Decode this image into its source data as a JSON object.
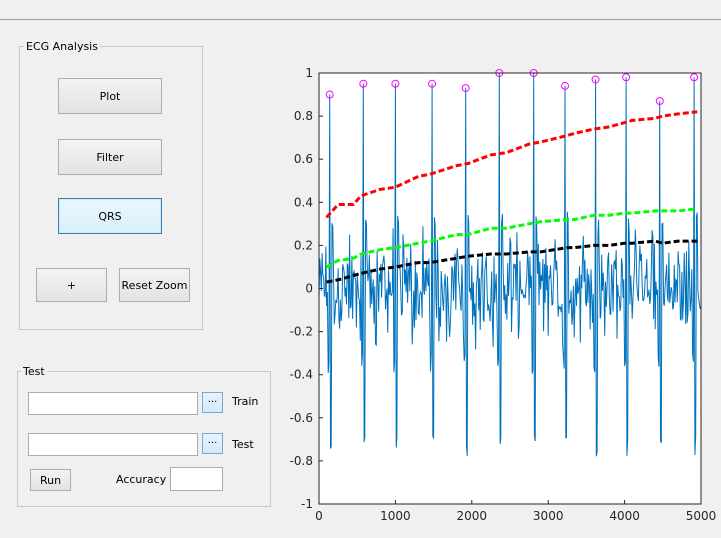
{
  "ecg_panel": {
    "title": "ECG Analysis",
    "plot_label": "Plot",
    "filter_label": "Filter",
    "qrs_label": "QRS",
    "plus_label": "+",
    "reset_zoom_label": "Reset Zoom"
  },
  "test_panel": {
    "title": "Test",
    "train_input_value": "",
    "train_browse_label": "...",
    "train_label": "Train",
    "test_input_value": "",
    "test_browse_label": "...",
    "test_label": "Test",
    "run_label": "Run",
    "accuracy_label": "Accuracy",
    "accuracy_value": ""
  },
  "colors": {
    "signal": "#0072bd",
    "peaks": "#ff00ff",
    "red_line": "#ff0000",
    "green_line": "#00ff00",
    "black_line": "#000000"
  },
  "chart_data": {
    "type": "line",
    "xlim": [
      0,
      5000
    ],
    "ylim": [
      -1,
      1
    ],
    "x_ticks": [
      0,
      1000,
      2000,
      3000,
      4000,
      5000
    ],
    "y_ticks": [
      -1,
      -0.8,
      -0.6,
      -0.4,
      -0.2,
      0,
      0.2,
      0.4,
      0.6,
      0.8,
      1
    ],
    "x_tick_labels": [
      "0",
      "1000",
      "2000",
      "3000",
      "4000",
      "5000"
    ],
    "y_tick_labels": [
      "-1",
      "-0.8",
      "-0.6",
      "-0.4",
      "-0.2",
      "0",
      "0.2",
      "0.4",
      "0.6",
      "0.8",
      "1"
    ],
    "grid": false,
    "peaks": {
      "x": [
        140,
        580,
        1000,
        1480,
        1920,
        2360,
        2810,
        3220,
        3620,
        4020,
        4460,
        4910
      ],
      "y": [
        0.9,
        0.95,
        0.95,
        0.95,
        0.93,
        1.0,
        1.0,
        0.94,
        0.97,
        0.98,
        0.87,
        0.98
      ]
    },
    "red_threshold": {
      "x": [
        100,
        250,
        450,
        550,
        800,
        1000,
        1300,
        1450,
        1800,
        1950,
        2250,
        2450,
        2750,
        2900,
        3250,
        3350,
        3600,
        3800,
        4000,
        4100,
        4400,
        4500,
        4700,
        4950
      ],
      "y": [
        0.33,
        0.39,
        0.39,
        0.43,
        0.46,
        0.47,
        0.52,
        0.53,
        0.57,
        0.58,
        0.62,
        0.63,
        0.67,
        0.68,
        0.71,
        0.72,
        0.74,
        0.75,
        0.77,
        0.78,
        0.79,
        0.8,
        0.81,
        0.82
      ]
    },
    "green_threshold": {
      "x": [
        100,
        250,
        450,
        550,
        800,
        1000,
        1300,
        1450,
        1800,
        1950,
        2250,
        2450,
        2750,
        2900,
        3250,
        3350,
        3600,
        3800,
        4000,
        4100,
        4400,
        4500,
        4700,
        4950
      ],
      "y": [
        0.1,
        0.13,
        0.14,
        0.16,
        0.18,
        0.19,
        0.21,
        0.22,
        0.25,
        0.25,
        0.28,
        0.28,
        0.3,
        0.31,
        0.32,
        0.32,
        0.34,
        0.34,
        0.35,
        0.35,
        0.36,
        0.36,
        0.36,
        0.37
      ]
    },
    "black_threshold": {
      "x": [
        100,
        250,
        450,
        550,
        800,
        1000,
        1300,
        1450,
        1800,
        1950,
        2250,
        2450,
        2750,
        2900,
        3250,
        3350,
        3600,
        3800,
        4000,
        4100,
        4400,
        4500,
        4700,
        4950
      ],
      "y": [
        0.03,
        0.04,
        0.06,
        0.07,
        0.09,
        0.1,
        0.12,
        0.12,
        0.14,
        0.15,
        0.16,
        0.16,
        0.17,
        0.17,
        0.19,
        0.19,
        0.2,
        0.2,
        0.21,
        0.21,
        0.22,
        0.21,
        0.22,
        0.22
      ]
    }
  }
}
